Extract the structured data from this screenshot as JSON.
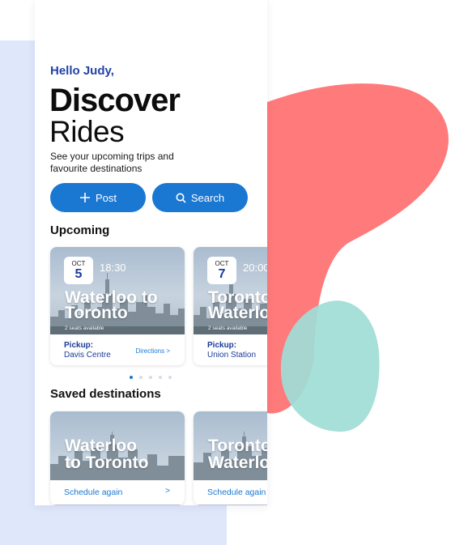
{
  "greeting": "Hello Judy,",
  "title_line1": "Discover",
  "title_line2": "Rides",
  "subtitle": "See your upcoming trips and favourite destinations",
  "actions": {
    "post_label": "Post",
    "search_label": "Search"
  },
  "upcoming": {
    "title": "Upcoming",
    "cards": [
      {
        "month": "OCT",
        "day": "5",
        "time": "18:30",
        "route_line1": "Waterloo to",
        "route_line2": "Toronto",
        "seats": "2 seats available",
        "pickup_label": "Pickup:",
        "pickup_place": "Davis Centre",
        "directions": "Directions >"
      },
      {
        "month": "OCT",
        "day": "7",
        "time": "20:00",
        "route_line1": "Toronto to",
        "route_line2": "Waterloo",
        "seats": "2 seats available",
        "pickup_label": "Pickup:",
        "pickup_place": "Union Station"
      }
    ],
    "pagination": {
      "total": 5,
      "active": 0
    }
  },
  "saved": {
    "title": "Saved destinations",
    "cards": [
      {
        "route_line1": "Waterloo",
        "route_line2": "to Toronto",
        "action": "Schedule again",
        "chevron": ">"
      },
      {
        "route_line1": "Toronto to",
        "route_line2": "Waterloo",
        "action": "Schedule again"
      }
    ]
  },
  "colors": {
    "accent": "#1a78d3",
    "navy": "#1a3c9a",
    "blob_red": "#ff7a7a",
    "blob_teal": "#9fdcd6",
    "backdrop": "#dfe7fb"
  }
}
